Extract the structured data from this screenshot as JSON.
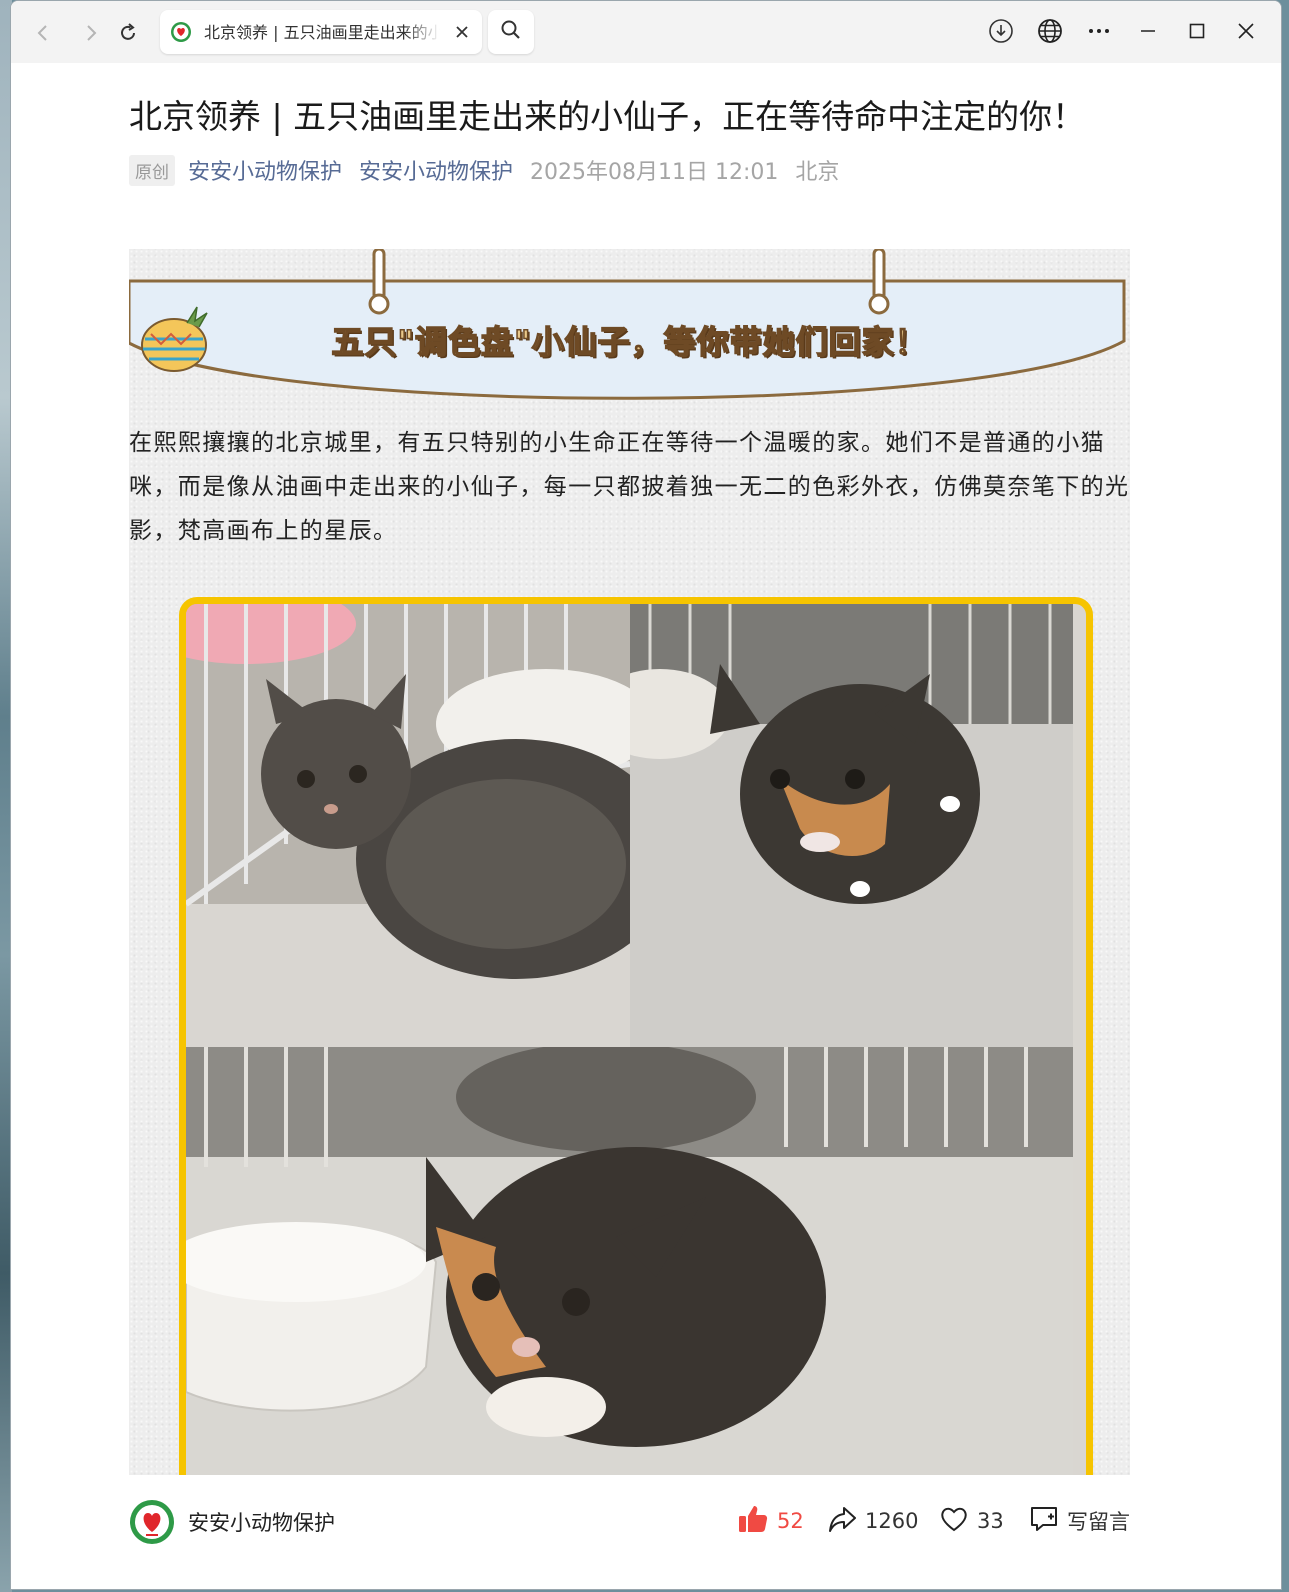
{
  "browser": {
    "tab_title": "北京领养 | 五只油画里走出来的小仙子，正在等待命中注定的你！",
    "icons": [
      "back-icon",
      "forward-icon",
      "reload-icon",
      "close-icon",
      "search-icon",
      "download-icon",
      "globe-icon",
      "more-icon",
      "minimize-icon",
      "maximize-icon",
      "window-close-icon"
    ]
  },
  "article": {
    "title": "北京领养 | 五只油画里走出来的小仙子，正在等待命中注定的你！",
    "tag": "原创",
    "author": "安安小动物保护",
    "account": "安安小动物保护",
    "date": "2025年08月11日 12:01",
    "location": "北京",
    "banner_text": "五只\"调色盘\"小仙子，等你带她们回家！",
    "intro": "在熙熙攘攘的北京城里，有五只特别的小生命正在等待一个温暖的家。她们不是普通的小猫咪，而是像从油画中走出来的小仙子，每一只都披着独一无二的色彩外衣，仿佛莫奈笔下的光影，梵高画布上的星辰。"
  },
  "footer": {
    "account_name": "安安小动物保护",
    "likes": "52",
    "shares": "1260",
    "favorites": "33",
    "comment_label": "写留言"
  },
  "colors": {
    "accent_link": "#576b95",
    "like_red": "#f04a43",
    "frame_yellow": "#f6c400",
    "banner_blue": "#e4eef8",
    "banner_brown": "#8b6a3e"
  }
}
